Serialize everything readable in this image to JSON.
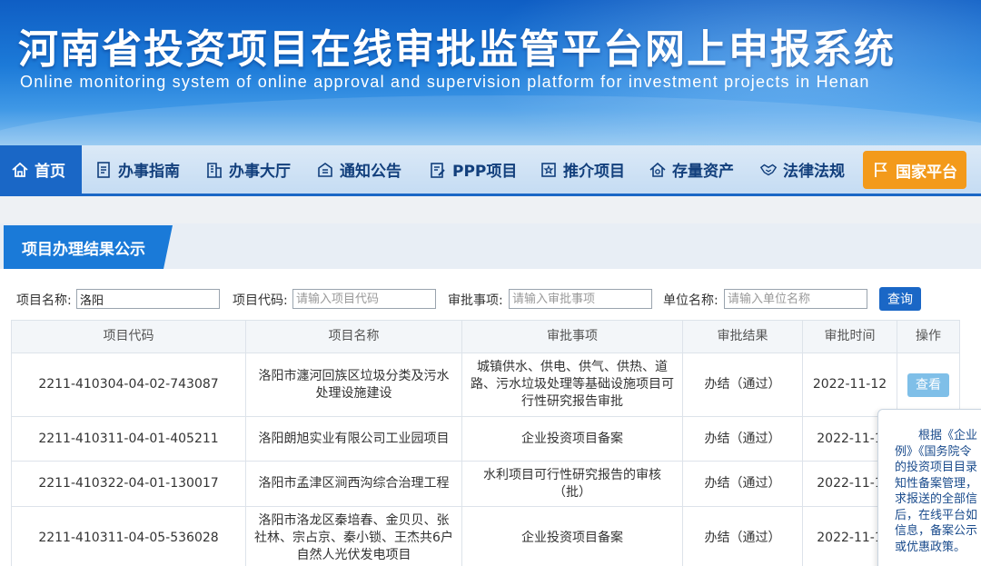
{
  "header": {
    "title": "河南省投资项目在线审批监管平台网上申报系统",
    "subtitle": "Online monitoring system of online approval and supervision platform for investment projects in Henan"
  },
  "nav": {
    "items": [
      {
        "label": "首页",
        "icon": "home-icon"
      },
      {
        "label": "办事指南",
        "icon": "document-icon"
      },
      {
        "label": "办事大厅",
        "icon": "building-icon"
      },
      {
        "label": "通知公告",
        "icon": "notice-icon"
      },
      {
        "label": "PPP项目",
        "icon": "edit-doc-icon"
      },
      {
        "label": "推介项目",
        "icon": "star-icon"
      },
      {
        "label": "存量资产",
        "icon": "house-icon"
      },
      {
        "label": "法律法规",
        "icon": "handshake-icon"
      },
      {
        "label": "国家平台",
        "icon": "flag-icon"
      }
    ]
  },
  "panel": {
    "title": "项目办理结果公示"
  },
  "filters": {
    "project_name_label": "项目名称:",
    "project_name_value": "洛阳",
    "project_code_label": "项目代码:",
    "project_code_placeholder": "请输入项目代码",
    "approval_item_label": "审批事项:",
    "approval_item_placeholder": "请输入审批事项",
    "unit_name_label": "单位名称:",
    "unit_name_placeholder": "请输入单位名称",
    "search_label": "查询"
  },
  "table": {
    "headers": [
      "项目代码",
      "项目名称",
      "审批事项",
      "审批结果",
      "审批时间",
      "操作"
    ],
    "rows": [
      {
        "code": "2211-410304-04-02-743087",
        "name": "洛阳市瀍河回族区垃圾分类及污水处理设施建设",
        "item": "城镇供水、供电、供气、供热、道路、污水垃圾处理等基础设施项目可行性研究报告审批",
        "result": "办结（通过）",
        "date": "2022-11-12",
        "action": "查看"
      },
      {
        "code": "2211-410311-04-01-405211",
        "name": "洛阳朗旭实业有限公司工业园项目",
        "item": "企业投资项目备案",
        "result": "办结（通过）",
        "date": "2022-11-1",
        "action": ""
      },
      {
        "code": "2211-410322-04-01-130017",
        "name": "洛阳市孟津区涧西沟综合治理工程",
        "item": "水利项目可行性研究报告的审核（批）",
        "result": "办结（通过）",
        "date": "2022-11-1",
        "action": ""
      },
      {
        "code": "2211-410311-04-05-536028",
        "name": "洛阳市洛龙区秦培春、金贝贝、张社林、宗占京、秦小锁、王杰共6户自然人光伏发电项目",
        "item": "企业投资项目备案",
        "result": "办结（通过）",
        "date": "2022-11-1",
        "action": ""
      }
    ]
  },
  "notice": {
    "lines": [
      "根据《企业",
      "例》《国务院令",
      "的投资项目目录",
      "知性备案管理，",
      "求报送的全部信",
      "后，在线平台如",
      "信息，备案公示",
      "或优惠政策。"
    ]
  },
  "colors": {
    "brand_blue": "#1a67c6",
    "accent_orange": "#f39a1b",
    "button_light": "#7fbfe8"
  }
}
